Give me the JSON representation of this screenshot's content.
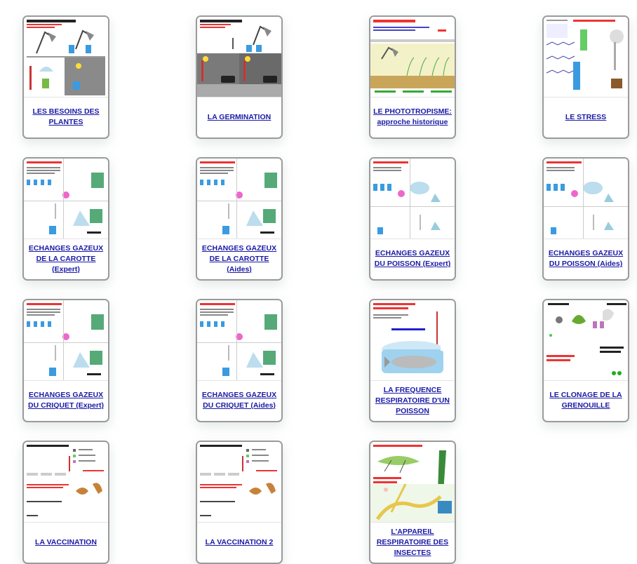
{
  "accent_color": "#1a1aa6",
  "cards": [
    {
      "title": "LES BESOINS DES PLANTES",
      "thumb_label": "LES BESOINS DES PLANTES VERTES",
      "scene": "lamps",
      "icon": "plants-experiment-icon"
    },
    {
      "title": "LA GERMINATION",
      "thumb_label": "LA GERMINATION DES GRAINES",
      "scene": "germ",
      "icon": "germination-experiment-icon"
    },
    {
      "title": "LE PHOTOTROPISME: approche historique",
      "thumb_label": "LE PHOTOTROPISME",
      "scene": "photo",
      "icon": "phototropism-experiment-icon"
    },
    {
      "title": "LE STRESS",
      "thumb_label": "LA REPONSE DE L'ORGANISME",
      "scene": "stress",
      "icon": "stress-experiment-icon"
    },
    {
      "title": "ECHANGES GAZEUX DE LA CAROTTE (Expert)",
      "thumb_label": "LES ECHANGES GAZEUX",
      "scene": "flask",
      "icon": "carrot-gas-exchange-icon"
    },
    {
      "title": "ECHANGES GAZEUX DE LA CAROTTE (Aides)",
      "thumb_label": "LES ECHANGES GAZEUX",
      "scene": "flask",
      "icon": "carrot-gas-exchange-icon"
    },
    {
      "title": "ECHANGES GAZEUX DU POISSON (Expert)",
      "thumb_label": "LES ECHANGES GAZEUX",
      "scene": "fishtank",
      "icon": "fish-gas-exchange-icon"
    },
    {
      "title": "ECHANGES GAZEUX DU POISSON (Aides)",
      "thumb_label": "LES ECHANGES GAZEUX",
      "scene": "fishtank",
      "icon": "fish-gas-exchange-icon"
    },
    {
      "title": "ECHANGES GAZEUX DU CRIQUET (Expert)",
      "thumb_label": "LES ECHANGES GAZEUX",
      "scene": "flask",
      "icon": "cricket-gas-exchange-icon"
    },
    {
      "title": "ECHANGES GAZEUX DU CRIQUET (Aides)",
      "thumb_label": "LES ECHANGES GAZEUX",
      "scene": "flask",
      "icon": "cricket-gas-exchange-icon"
    },
    {
      "title": "LA FREQUENCE RESPIRATOIRE D'UN POISSON",
      "thumb_label": "Fréquence respiratoire",
      "scene": "fish",
      "icon": "fish-respiration-icon"
    },
    {
      "title": "LE CLONAGE DE LA GRENOUILLE",
      "thumb_label": "Grenouille verte",
      "scene": "frog",
      "icon": "frog-cloning-icon"
    },
    {
      "title": "LA VACCINATION",
      "thumb_label": "LES EXPERIENCES DE PASTEUR",
      "scene": "pasteur",
      "icon": "vaccination-experiment-icon"
    },
    {
      "title": "LA VACCINATION 2",
      "thumb_label": "LES EXPERIENCES DE PASTEUR",
      "scene": "pasteur",
      "icon": "vaccination-experiment-icon"
    },
    {
      "title": "L'APPAREIL RESPIRATOIRE DES INSECTES",
      "thumb_label": "L'APPAREIL RESPIRATOIRE DES INSECTES",
      "scene": "insect",
      "icon": "insect-respiration-icon"
    }
  ]
}
